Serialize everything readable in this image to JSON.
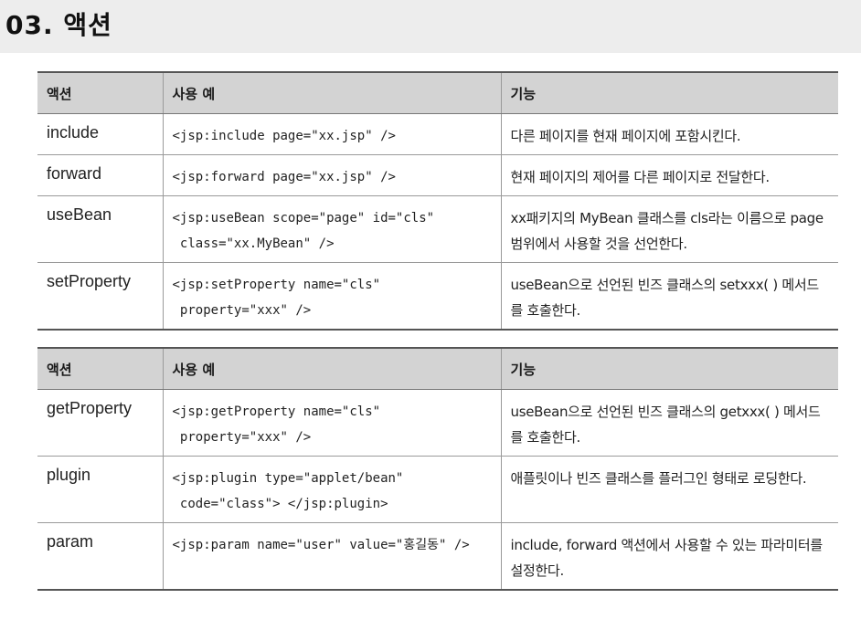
{
  "section": {
    "title": "03. 액션"
  },
  "headers": {
    "action": "액션",
    "example": "사용 예",
    "function": "기능"
  },
  "table1": [
    {
      "action": "include",
      "example": "<jsp:include page=\"xx.jsp\" />",
      "desc": "다른 페이지를 현재 페이지에 포함시킨다."
    },
    {
      "action": "forward",
      "example": "<jsp:forward page=\"xx.jsp\" />",
      "desc": "현재 페이지의 제어를 다른 페이지로 전달한다."
    },
    {
      "action": "useBean",
      "example": "<jsp:useBean scope=\"page\" id=\"cls\"\n class=\"xx.MyBean\" />",
      "desc": "xx패키지의 MyBean 클래스를 cls라는 이름으로 page 범위에서 사용할 것을 선언한다."
    },
    {
      "action": "setProperty",
      "example": "<jsp:setProperty name=\"cls\"\n property=\"xxx\" />",
      "desc": "useBean으로 선언된 빈즈 클래스의 setxxx( ) 메서드를 호출한다."
    }
  ],
  "table2": [
    {
      "action": "getProperty",
      "example": "<jsp:getProperty name=\"cls\"\n property=\"xxx\" />",
      "desc": "useBean으로 선언된 빈즈 클래스의 getxxx( ) 메서드를 호출한다."
    },
    {
      "action": "plugin",
      "example": "<jsp:plugin type=\"applet/bean\"\n code=\"class\"> </jsp:plugin>",
      "desc": "애플릿이나 빈즈 클래스를 플러그인 형태로 로딩한다."
    },
    {
      "action": "param",
      "example": "<jsp:param name=\"user\" value=\"홍길동\" />",
      "desc": "include, forward 액션에서 사용할 수 있는 파라미터를 설정한다."
    }
  ]
}
